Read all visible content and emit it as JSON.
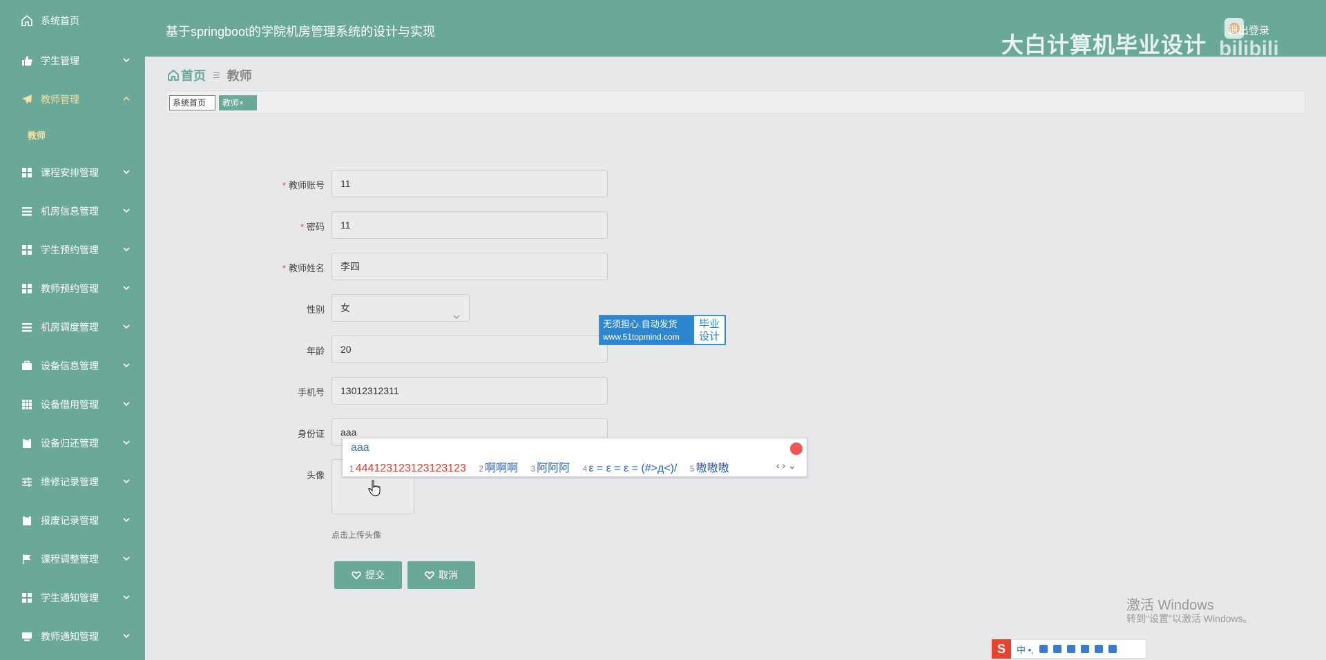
{
  "sidebar": {
    "items": [
      {
        "label": "系统首页",
        "icon": "home-icon"
      },
      {
        "label": "学生管理",
        "icon": "thumbs-icon"
      },
      {
        "label": "教师管理",
        "icon": "send-icon"
      },
      {
        "label": "课程安排管理",
        "icon": "grid-icon"
      },
      {
        "label": "机房信息管理",
        "icon": "menu-icon"
      },
      {
        "label": "学生预约管理",
        "icon": "grid-icon"
      },
      {
        "label": "教师预约管理",
        "icon": "grid-icon"
      },
      {
        "label": "机房调度管理",
        "icon": "menu-icon"
      },
      {
        "label": "设备信息管理",
        "icon": "briefcase-icon"
      },
      {
        "label": "设备借用管理",
        "icon": "table-icon"
      },
      {
        "label": "设备归还管理",
        "icon": "clipboard-icon"
      },
      {
        "label": "维修记录管理",
        "icon": "sliders-icon"
      },
      {
        "label": "报废记录管理",
        "icon": "clipboard-icon"
      },
      {
        "label": "课程调整管理",
        "icon": "flag-icon"
      },
      {
        "label": "学生通知管理",
        "icon": "grid-icon"
      },
      {
        "label": "教师通知管理",
        "icon": "monitor-icon"
      }
    ],
    "sub_item": "教师"
  },
  "header": {
    "title": "基于springboot的学院机房管理系统的设计与实现",
    "watermark": "大白计算机毕业设计",
    "logout": "退出登录"
  },
  "breadcrumb": {
    "home": "首页",
    "current": "教师"
  },
  "tabs": {
    "tab1": "系统首页",
    "tab2": "教师×"
  },
  "form": {
    "account_label": "教师账号",
    "account_value": "11",
    "password_label": "密码",
    "password_value": "11",
    "name_label": "教师姓名",
    "name_value": "李四",
    "gender_label": "性别",
    "gender_value": "女",
    "age_label": "年龄",
    "age_value": "20",
    "phone_label": "手机号",
    "phone_value": "13012312311",
    "idcard_label": "身份证",
    "idcard_value": "aaa",
    "avatar_label": "头像",
    "avatar_hint": "点击上传头像",
    "submit": "提交",
    "cancel": "取消"
  },
  "ad": {
    "line1": "无须担心.自动发货",
    "line2": "www.51topmind.com",
    "right1": "毕业",
    "right2": "设计"
  },
  "ime": {
    "input": "aaa",
    "candidates": [
      {
        "n": "1",
        "text": "444123123123123123"
      },
      {
        "n": "2",
        "text": "啊啊啊"
      },
      {
        "n": "3",
        "text": "阿阿阿"
      },
      {
        "n": "4",
        "text": "ε = ε = ε = (#>д<)/"
      },
      {
        "n": "5",
        "text": "嗷嗷嗷"
      }
    ],
    "nav": "‹ › ⌄"
  },
  "activation": {
    "title": "激活 Windows",
    "sub": "转到\"设置\"以激活 Windows。"
  },
  "imebar": {
    "logo": "S",
    "text": "中 •, "
  }
}
